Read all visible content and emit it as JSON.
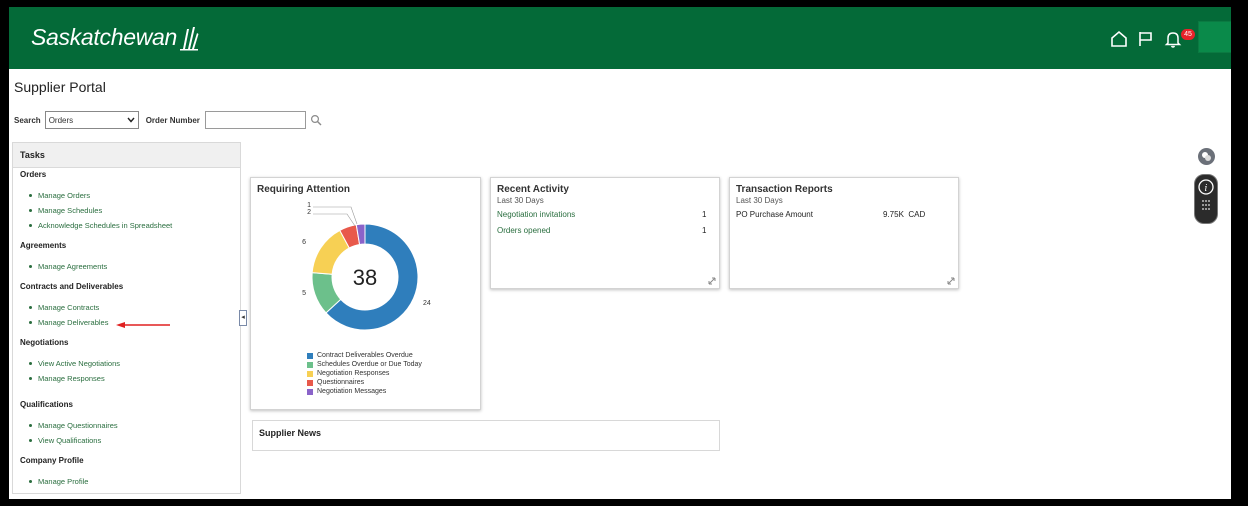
{
  "header": {
    "brand": "Saskatchewan",
    "icons": [
      "home-icon",
      "flag-icon",
      "bell-icon"
    ],
    "notification_count": "45",
    "colors": {
      "brand_green": "#046a38",
      "badge_red": "#e8232a",
      "link_green": "#2a6e3f"
    }
  },
  "page": {
    "title": "Supplier Portal"
  },
  "search": {
    "label": "Search",
    "selected": "Orders",
    "order_label": "Order Number",
    "order_value": ""
  },
  "tasks": {
    "title": "Tasks",
    "groups": [
      {
        "name": "Orders",
        "links": [
          "Manage Orders",
          "Manage Schedules",
          "Acknowledge Schedules in Spreadsheet"
        ]
      },
      {
        "name": "Agreements",
        "links": [
          "Manage Agreements"
        ]
      },
      {
        "name": "Contracts and Deliverables",
        "links": [
          "Manage Contracts",
          "Manage Deliverables"
        ]
      },
      {
        "name": "Negotiations",
        "links": [
          "View Active Negotiations",
          "Manage Responses"
        ]
      },
      {
        "name": "Qualifications",
        "links": [
          "Manage Questionnaires",
          "View Qualifications"
        ]
      },
      {
        "name": "Company Profile",
        "links": [
          "Manage Profile"
        ]
      }
    ]
  },
  "requiring_attention": {
    "title": "Requiring Attention",
    "total": "38",
    "chart_data": {
      "type": "pie",
      "categories": [
        "Contract Deliverables Overdue",
        "Schedules Overdue or Due Today",
        "Negotiation Responses",
        "Questionnaires",
        "Negotiation Messages"
      ],
      "values": [
        24,
        5,
        6,
        2,
        1
      ],
      "colors": [
        "#2f7ebc",
        "#6cc08b",
        "#f7d054",
        "#e8594b",
        "#8a63c9"
      ],
      "value_labels": [
        "24",
        "5",
        "6",
        "2",
        "1"
      ],
      "legend_position": "bottom"
    }
  },
  "recent_activity": {
    "title": "Recent Activity",
    "subtitle": "Last 30 Days",
    "rows": [
      {
        "label": "Negotiation invitations",
        "value": "1"
      },
      {
        "label": "Orders opened",
        "value": "1"
      }
    ]
  },
  "transaction_reports": {
    "title": "Transaction Reports",
    "subtitle": "Last 30 Days",
    "rows": [
      {
        "label": "PO Purchase Amount",
        "value": "9.75K  CAD"
      }
    ]
  },
  "supplier_news": {
    "title": "Supplier News"
  }
}
